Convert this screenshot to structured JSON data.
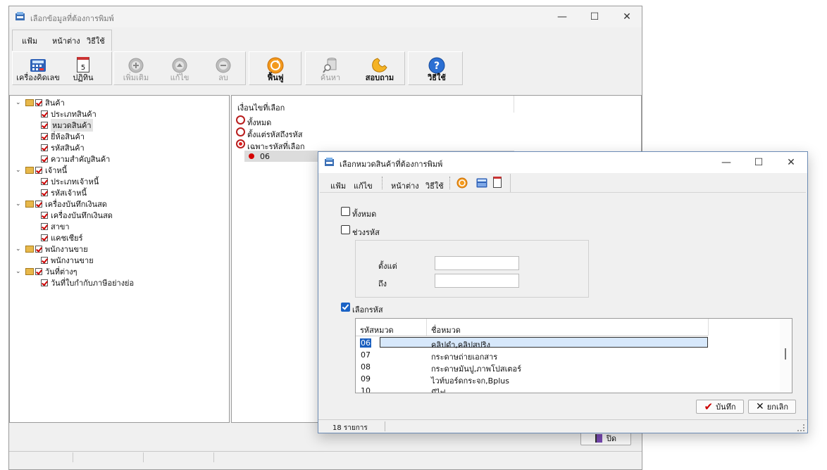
{
  "bg_window": {
    "title": "เลือกข้อมูลที่ต้องการพิมพ์",
    "menu": [
      "แฟ้ม",
      "หน้าต่าง",
      "วิธีใช้"
    ],
    "toolbar": {
      "calc": "เครื่องคิดเลข",
      "calendar": "ปฏิทิน",
      "calendar_day": "5",
      "add": "เพิ่มเติม",
      "edit": "แก้ไข",
      "delete": "ลบ",
      "refresh": "ฟื้นฟู",
      "search": "ค้นหา",
      "inquiry": "สอบถาม",
      "help": "วิธีใช้"
    },
    "tree": [
      {
        "label": "สินค้า",
        "children": [
          "ประเภทสินค้า",
          "หมวดสินค้า",
          "ยี่ห้อสินค้า",
          "รหัสสินค้า",
          "ความสำคัญสินค้า"
        ]
      },
      {
        "label": "เจ้าหนี้",
        "children": [
          "ประเภทเจ้าหนี้",
          "รหัสเจ้าหนี้"
        ]
      },
      {
        "label": "เครื่องบันทึกเงินสด",
        "children": [
          "เครื่องบันทึกเงินสด",
          "สาขา",
          "แคชเชียร์"
        ]
      },
      {
        "label": "พนักงานขาย",
        "children": [
          "พนักงานขาย"
        ]
      },
      {
        "label": "วันที่ต่างๆ",
        "children": [
          "วันที่ใบกำกับภาษีอย่างย่อ"
        ]
      }
    ],
    "condition": {
      "header": "เงื่อนไขที่เลือก",
      "options": [
        "ทั้งหมด",
        "ตั้งแต่รหัสถึงรหัส",
        "เฉพาะรหัสที่เลือก"
      ],
      "selected_code": "06"
    },
    "close_button": "ปิด"
  },
  "dialog": {
    "title": "เลือกหมวดสินค้าที่ต้องการพิมพ์",
    "menu": [
      "แฟ้ม",
      "แก้ไข",
      "หน้าต่าง",
      "วิธีใช้"
    ],
    "opt_all": "ทั้งหมด",
    "opt_range": "ช่วงรหัส",
    "from_label": "ตั้งแต่",
    "to_label": "ถึง",
    "opt_select": "เลือกรหัส",
    "grid": {
      "col_code": "รหัสหมวด",
      "col_name": "ชื่อหมวด",
      "rows": [
        {
          "code": "06",
          "name": "คลิปดำ,คลิปสปริง"
        },
        {
          "code": "07",
          "name": "กระดาษถ่ายเอกสาร"
        },
        {
          "code": "08",
          "name": "กระดาษมันปู,ภาพโปสเตอร์"
        },
        {
          "code": "09",
          "name": "ไวท์บอร์ดกระจก,Bplus"
        },
        {
          "code": "10",
          "name": "มีไฟ"
        }
      ]
    },
    "save": "บันทึก",
    "cancel": "ยกเลิก",
    "status": "18 รายการ"
  }
}
